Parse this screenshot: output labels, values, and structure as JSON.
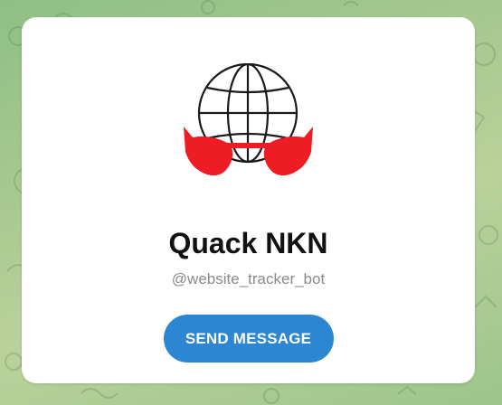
{
  "profile": {
    "name": "Quack NKN",
    "username": "@website_tracker_bot",
    "avatar_icon": "globe-with-red-sunglasses-icon"
  },
  "actions": {
    "send_message_label": "SEND MESSAGE"
  },
  "colors": {
    "button": "#2d86d1",
    "background": "#a7c98f",
    "sunglasses": "#ee1c24"
  }
}
